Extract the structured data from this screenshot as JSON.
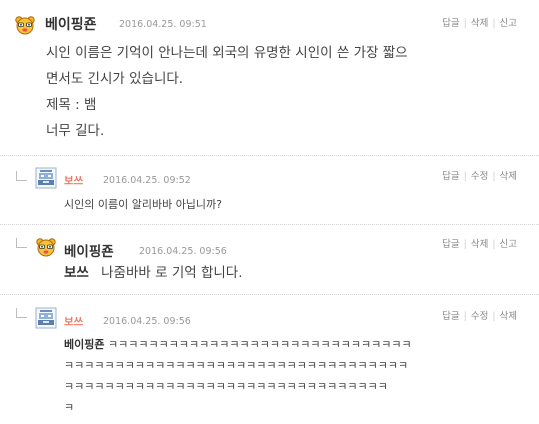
{
  "comments": [
    {
      "author": "베이핑죤",
      "date": "2016.04.25. 09:51",
      "actions": [
        "답글",
        "삭제",
        "신고"
      ],
      "lines": [
        "시인 이름은 기억이 안나는데 외국의 유명한 시인이 쓴 가장 짧으",
        "면서도 긴시가 있습니다.",
        "제목 : 뱀",
        "너무 길다."
      ]
    },
    {
      "author": "보쓰",
      "date": "2016.04.25. 09:52",
      "actions": [
        "답글",
        "수정",
        "삭제"
      ],
      "lines": [
        "시인의 이름이 알리바바 아닙니까?"
      ]
    },
    {
      "author": "베이핑죤",
      "date": "2016.04.25. 09:56",
      "actions": [
        "답글",
        "삭제",
        "신고"
      ],
      "mention": "보쓰",
      "text": "나줌바바 로 기억 합니다."
    },
    {
      "author": "보쓰",
      "date": "2016.04.25. 09:56",
      "actions": [
        "답글",
        "수정",
        "삭제"
      ],
      "mention": "베이핑죤",
      "lines": [
        "ㅋㅋㅋㅋㅋㅋㅋㅋㅋㅋㅋㅋㅋㅋㅋㅋㅋㅋㅋㅋㅋㅋㅋㅋㅋㅋㅋㅋㅋㅋ",
        "ㅋㅋㅋㅋㅋㅋㅋㅋㅋㅋㅋㅋㅋㅋㅋㅋㅋㅋㅋㅋㅋㅋㅋㅋㅋㅋㅋㅋㅋㅋㅋㅋㅋㅋ",
        "ㅋㅋㅋㅋㅋㅋㅋㅋㅋㅋㅋㅋㅋㅋㅋㅋㅋㅋㅋㅋㅋㅋㅋㅋㅋㅋㅋㅋㅋㅋㅋㅋ",
        "ㅋ"
      ]
    }
  ],
  "colors": {
    "author_dark": "#333333",
    "author_accent": "#ee7b6a",
    "meta": "#999999",
    "separator": "#d4d4d4"
  }
}
